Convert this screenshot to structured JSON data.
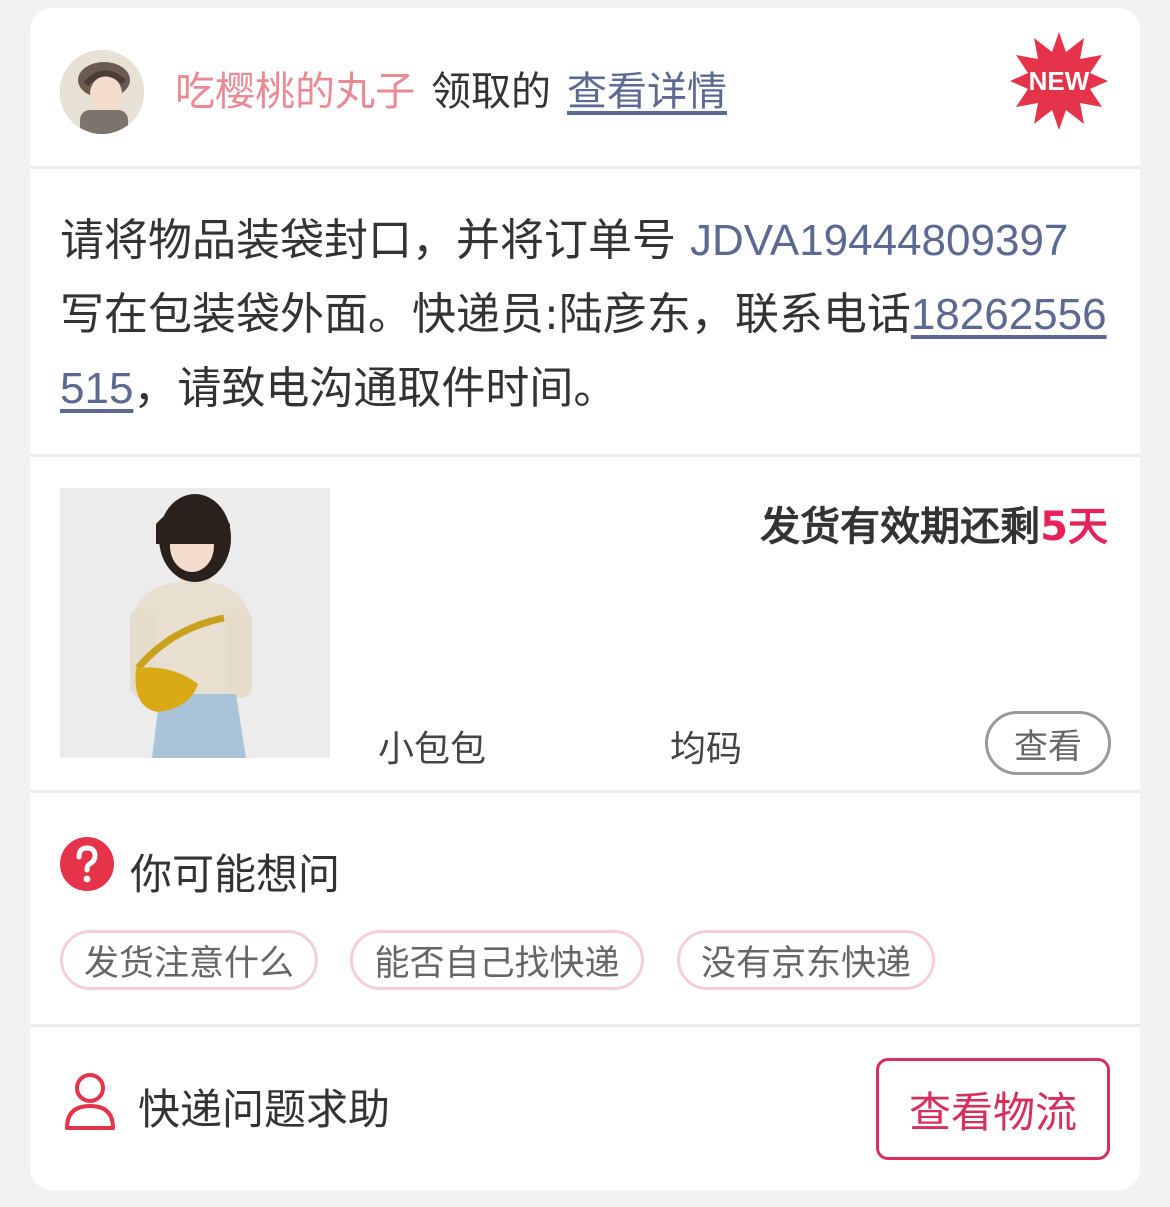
{
  "header": {
    "claimer_name": "吃樱桃的丸子",
    "claim_text": "领取的",
    "detail_link": "查看详情",
    "badge": "NEW"
  },
  "instruction": {
    "prefix": "请将物品装袋封口，并将订单号 ",
    "order_number": "JDVA19444809397",
    "middle": " 写在包装袋外面。快递员:陆彦东，联系电话",
    "phone": "18262556515",
    "suffix": "，请致电沟通取件时间。"
  },
  "product": {
    "validity_prefix": "发货有效期还剩",
    "validity_days": "5天",
    "name": "小包包",
    "size": "均码",
    "view_button": "查看"
  },
  "faq": {
    "title": "你可能想问",
    "chips": [
      "发货注意什么",
      "能否自己找快递",
      "没有京东快递"
    ]
  },
  "footer": {
    "help_text": "快递问题求助",
    "logistics_button": "查看物流"
  },
  "colors": {
    "accent": "#d62f5c",
    "link": "#5c6a93",
    "claimer": "#e98a95",
    "badge": "#e5344a"
  }
}
